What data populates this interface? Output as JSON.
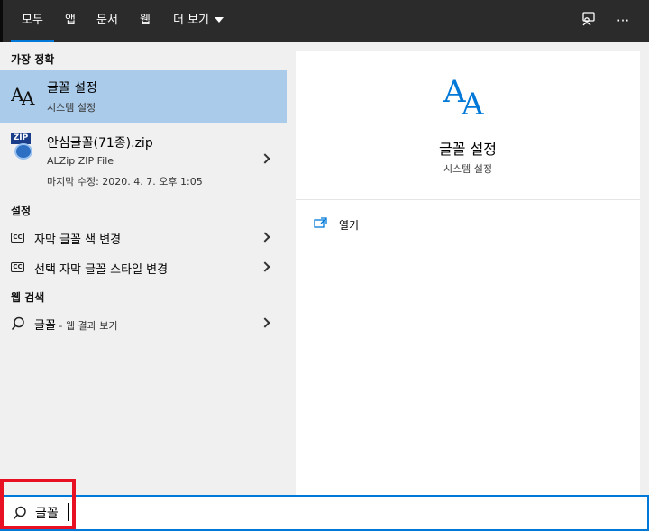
{
  "tabs": [
    {
      "label": "모두",
      "active": true
    },
    {
      "label": "앱",
      "active": false
    },
    {
      "label": "문서",
      "active": false
    },
    {
      "label": "웹",
      "active": false
    },
    {
      "label": "더 보기",
      "active": false
    }
  ],
  "top_icons": [
    "feedback-icon",
    "more-icon"
  ],
  "more_glyph": "···",
  "best_match": {
    "section": "가장 정확",
    "title": "글꼴 설정",
    "subtitle": "시스템 설정"
  },
  "file_result": {
    "title": "안심글꼴(71종).zip",
    "type": "ALZip ZIP File",
    "modified": "마지막 수정: 2020. 4. 7. 오후 1:05",
    "icon_label": "ZIP"
  },
  "settings": {
    "section": "설정",
    "items": [
      {
        "label": "자막 글꼴 색 변경",
        "icon": "cc-icon"
      },
      {
        "label": "선택 자막 글꼴 스타일 변경",
        "icon": "cc-icon"
      }
    ]
  },
  "web": {
    "section": "웹 검색",
    "query": "글꼴",
    "suffix": " - 웹 결과 보기"
  },
  "preview": {
    "title": "글꼴 설정",
    "subtitle": "시스템 설정",
    "action": "열기",
    "icon_text": "AA"
  },
  "cc_glyph": "CC",
  "search": {
    "value": "글꼴"
  },
  "colors": {
    "accent": "#0078d7",
    "selected_row": "#aacbea",
    "highlight": "#e81123"
  }
}
